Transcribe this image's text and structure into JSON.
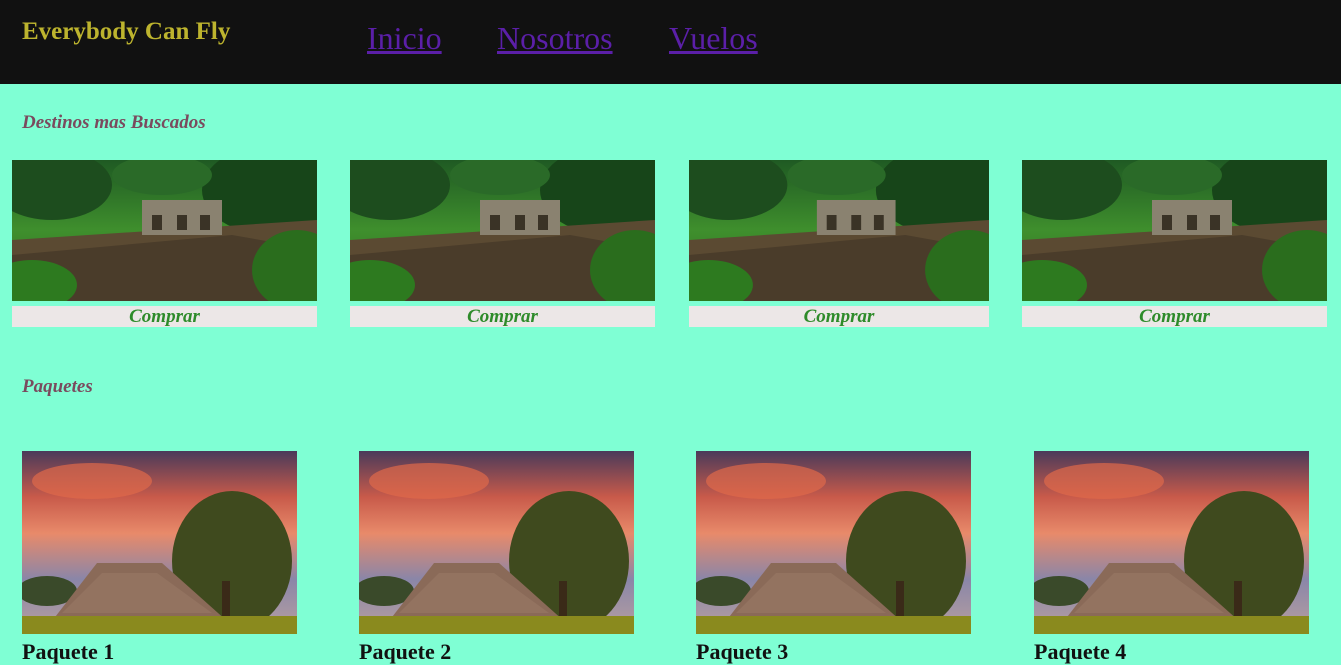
{
  "header": {
    "brand": "Everybody Can Fly",
    "nav": [
      "Inicio",
      "Nosotros",
      "Vuelos"
    ]
  },
  "destinos": {
    "title": "Destinos mas Buscados",
    "cards": [
      {
        "button": "Comprar"
      },
      {
        "button": "Comprar"
      },
      {
        "button": "Comprar"
      },
      {
        "button": "Comprar"
      }
    ]
  },
  "paquetes": {
    "title": "Paquetes",
    "cards": [
      {
        "title": "Paquete 1"
      },
      {
        "title": "Paquete 2"
      },
      {
        "title": "Paquete 3"
      },
      {
        "title": "Paquete 4"
      }
    ]
  },
  "colors": {
    "background": "#7fffd4",
    "header": "#111111",
    "brand": "#bdb42e",
    "nav_link": "#5b1fa8",
    "section_title": "#7a4a5e",
    "button_text": "#2e8b2a",
    "button_bg": "#ece7e7"
  }
}
